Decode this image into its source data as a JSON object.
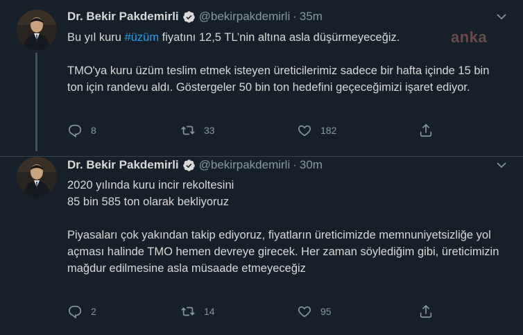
{
  "colors": {
    "background": "#15202b",
    "text": "#d9d9d9",
    "muted": "#8899a6",
    "hashtag": "#1da1f2",
    "verified": "#d9d9d9"
  },
  "tweets": [
    {
      "name": "Dr. Bekir Pakdemirli",
      "handle": "@bekirpakdemirli",
      "separator": "·",
      "time": "35m",
      "text_before_hashtag": "Bu yıl kuru ",
      "hashtag": "#üzüm",
      "text_after_hashtag": " fiyatını 12,5 TL’nin altına asla düşürmeyeceğiz.",
      "paragraph2": "TMO'ya kuru üzüm teslim etmek isteyen üreticilerimiz sadece bir hafta içinde 15 bin ton için randevu aldı. Göstergeler 50 bin ton hedefini geçeceğimizi işaret ediyor.",
      "watermark": "anka",
      "replies": "8",
      "retweets": "33",
      "likes": "182",
      "icons": [
        "reply-icon",
        "retweet-icon",
        "like-icon",
        "share-icon",
        "verified-icon",
        "caret-down-icon"
      ]
    },
    {
      "name": "Dr. Bekir Pakdemirli",
      "handle": "@bekirpakdemirli",
      "separator": "·",
      "time": "30m",
      "line1": "2020 yılında kuru incir rekoltesini",
      "line2": "85 bin 585 ton olarak bekliyoruz",
      "paragraph2": "Piyasaları çok yakından takip ediyoruz, fiyatların üreticimizde memnuniyetsizliğe yol açması halinde TMO hemen devreye girecek. Her zaman söylediğim gibi, üreticimizin mağdur edilmesine asla müsaade etmeyeceğiz",
      "replies": "2",
      "retweets": "14",
      "likes": "95",
      "icons": [
        "reply-icon",
        "retweet-icon",
        "like-icon",
        "share-icon",
        "verified-icon",
        "caret-down-icon"
      ]
    }
  ]
}
